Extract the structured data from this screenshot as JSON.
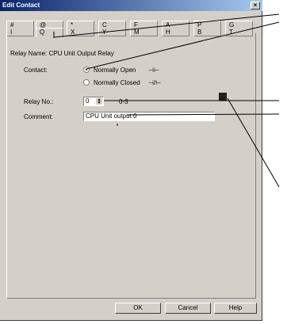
{
  "window": {
    "title": "Edit Contact",
    "close_glyph": "×"
  },
  "tabs": {
    "row1": [
      "#",
      "@",
      "*",
      "C",
      "F",
      "A",
      "P",
      "G"
    ],
    "row2": [
      "I",
      "Q",
      "X",
      "Y",
      "M",
      "H",
      "B",
      "T"
    ]
  },
  "relay_name": "Relay Name: CPU Unit Output Relay",
  "contact": {
    "label": "Contact:",
    "option_open": "Normally Open",
    "option_closed": "Normally Closed",
    "symbol_open": "⊣⊢",
    "symbol_closed": "⊣/⊢",
    "selected": "open"
  },
  "relay_no": {
    "label": "Relay No.:",
    "value": "0",
    "range": "0-3"
  },
  "comment": {
    "label": "Comment:",
    "value": "CPU Unit output 0"
  },
  "buttons": {
    "ok": "OK",
    "cancel": "Cancel",
    "help": "Help"
  }
}
